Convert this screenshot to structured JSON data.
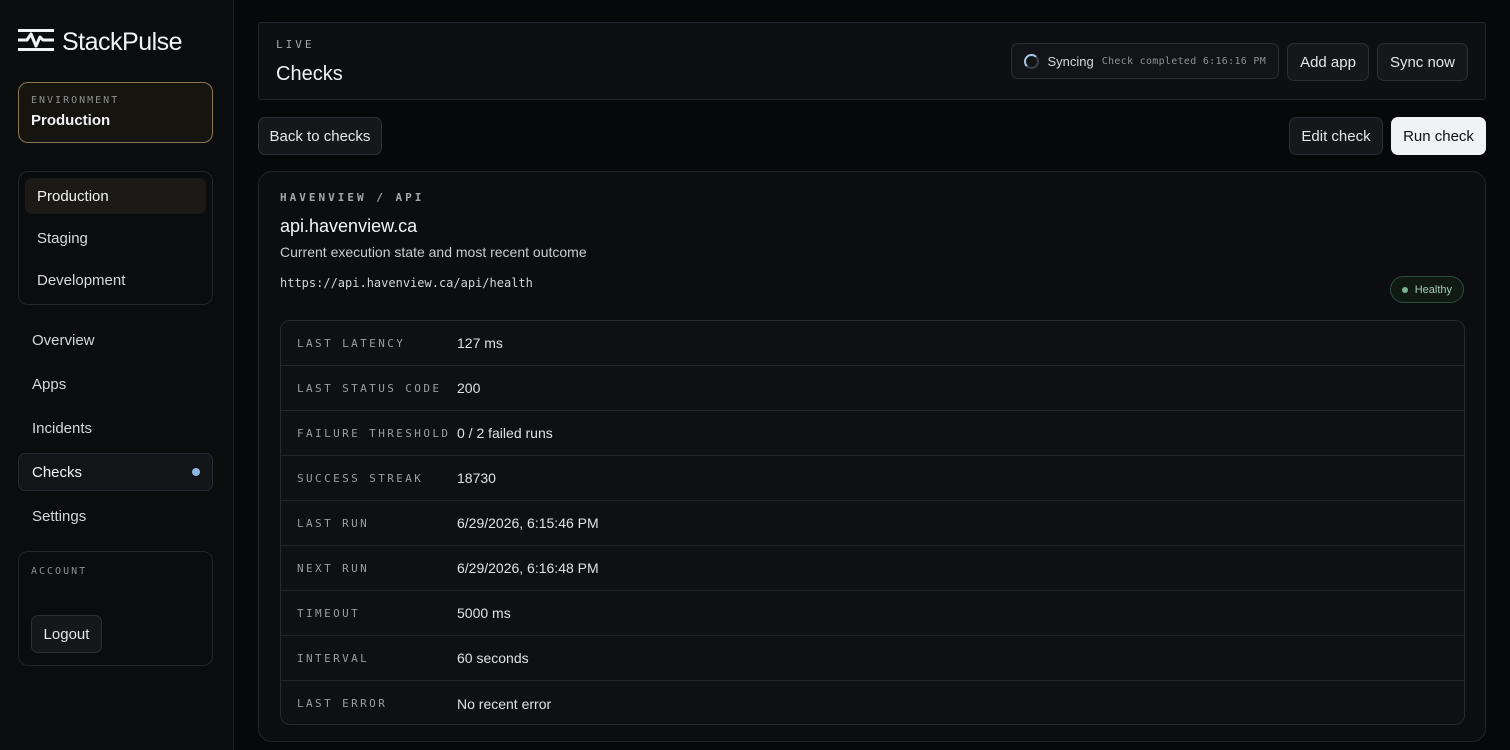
{
  "brand": {
    "name": "StackPulse"
  },
  "environment": {
    "label": "ENVIRONMENT",
    "value": "Production"
  },
  "env_options": [
    {
      "label": "Production",
      "active": true
    },
    {
      "label": "Staging",
      "active": false
    },
    {
      "label": "Development",
      "active": false
    }
  ],
  "nav": [
    {
      "label": "Overview"
    },
    {
      "label": "Apps"
    },
    {
      "label": "Incidents"
    },
    {
      "label": "Checks",
      "active": true
    },
    {
      "label": "Settings"
    }
  ],
  "account": {
    "label": "ACCOUNT",
    "logout_label": "Logout"
  },
  "header": {
    "eyebrow": "LIVE",
    "title": "Checks",
    "sync_label": "Syncing",
    "sync_status": "Check completed 6:16:16 PM",
    "add_app_label": "Add app",
    "sync_now_label": "Sync now"
  },
  "toolbar": {
    "back_label": "Back to checks",
    "edit_label": "Edit check",
    "run_label": "Run check"
  },
  "check": {
    "eyebrow": "HAVENVIEW / API",
    "title": "api.havenview.ca",
    "description": "Current execution state and most recent outcome",
    "url": "https://api.havenview.ca/api/health",
    "status": "Healthy",
    "details": [
      {
        "key": "LAST LATENCY",
        "value": "127 ms"
      },
      {
        "key": "LAST STATUS CODE",
        "value": "200"
      },
      {
        "key": "FAILURE THRESHOLD",
        "value": "0 / 2 failed runs"
      },
      {
        "key": "SUCCESS STREAK",
        "value": "18730"
      },
      {
        "key": "LAST RUN",
        "value": "6/29/2026, 6:15:46 PM"
      },
      {
        "key": "NEXT RUN",
        "value": "6/29/2026, 6:16:48 PM"
      },
      {
        "key": "TIMEOUT",
        "value": "5000 ms"
      },
      {
        "key": "INTERVAL",
        "value": "60 seconds"
      },
      {
        "key": "LAST ERROR",
        "value": "No recent error"
      }
    ]
  },
  "colors": {
    "accent": "#8fb6dc",
    "healthy": "#79b091",
    "env_border": "#8a7754"
  }
}
